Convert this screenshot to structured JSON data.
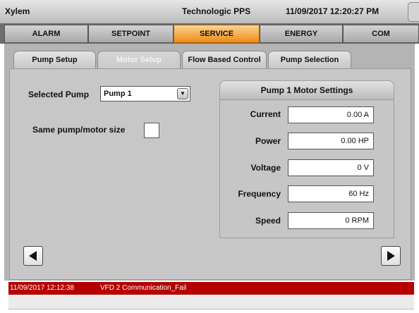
{
  "header": {
    "app_name": "Xylem",
    "center_title": "Technologic PPS",
    "datetime": "11/09/2017 12:20:27 PM"
  },
  "nav": {
    "tabs": [
      "ALARM",
      "SETPOINT",
      "SERVICE",
      "ENERGY",
      "COM"
    ],
    "active": "SERVICE"
  },
  "subtabs": {
    "items": [
      "Pump Setup",
      "Motor Setup",
      "Flow Based Control",
      "Pump Selection"
    ],
    "active": "Motor Setup"
  },
  "form": {
    "selected_pump_label": "Selected Pump",
    "selected_pump_value": "Pump 1",
    "same_size_label": "Same pump/motor size",
    "same_size_checked": false
  },
  "motor_settings": {
    "title": "Pump 1  Motor Settings",
    "fields": [
      {
        "label": "Current",
        "value": "0.00 A"
      },
      {
        "label": "Power",
        "value": "0.00 HP"
      },
      {
        "label": "Voltage",
        "value": "0 V"
      },
      {
        "label": "Frequency",
        "value": "60 Hz"
      },
      {
        "label": "Speed",
        "value": "0 RPM"
      }
    ]
  },
  "navigation_icons": {
    "previous": "triangle-left-icon",
    "next": "triangle-right-icon"
  },
  "alarm": {
    "timestamp": "11/09/2017 12:12:38",
    "message": "VFD 2 Communication_Fail"
  },
  "colors": {
    "accent_tab": "#f08a18",
    "alarm_bar": "#b40000"
  }
}
